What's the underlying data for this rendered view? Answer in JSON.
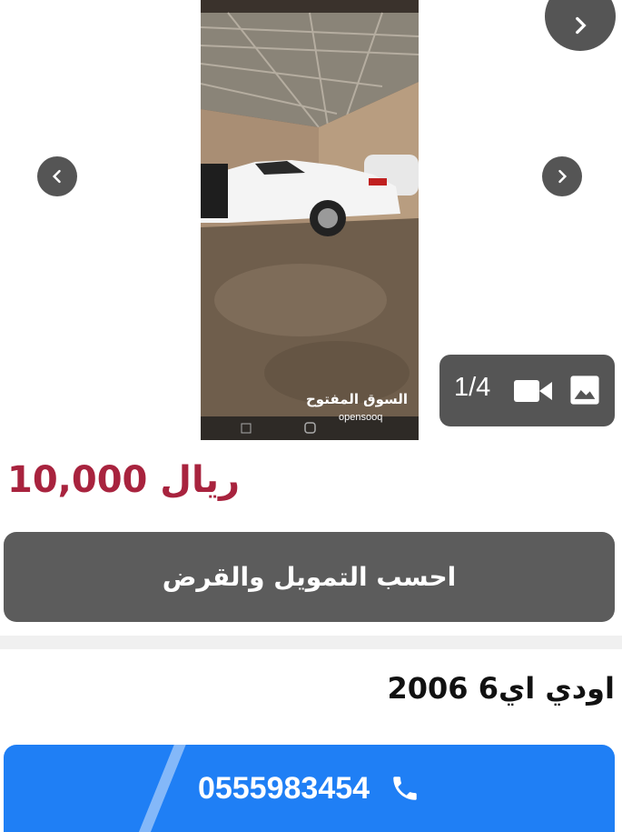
{
  "listing": {
    "image_counter": "1/4",
    "price": "10,000 ريال",
    "calc_button_label": "احسب التمويل والقرض",
    "title": "اودي اي6 2006",
    "phone_number": "0555983454"
  },
  "photo_overlay": {
    "watermark_arabic": "السوق المفتوح",
    "watermark_latin": "opensooq"
  },
  "colors": {
    "price": "#a8233e",
    "call_button": "#1f7ff5",
    "dark_button": "#5c5c5c",
    "nav_button": "#555555"
  },
  "icons": {
    "prev": "chevron-left-icon",
    "next": "chevron-right-icon",
    "video": "video-camera-icon",
    "image": "image-icon",
    "phone": "phone-icon"
  }
}
